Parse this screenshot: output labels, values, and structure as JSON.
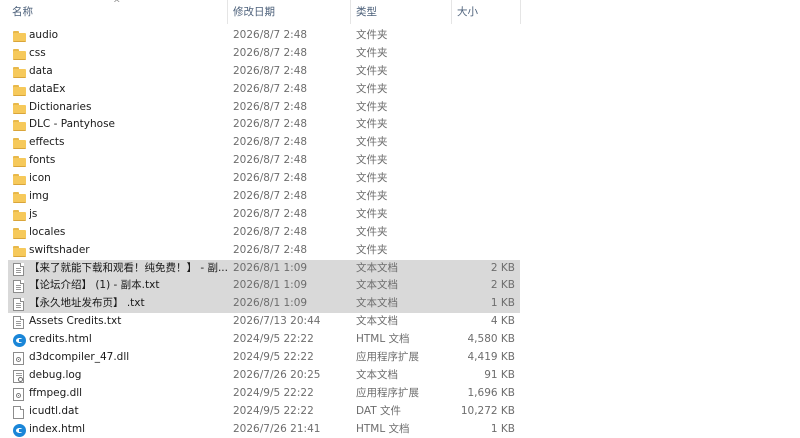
{
  "columns": {
    "name": "名称",
    "date": "修改日期",
    "type": "类型",
    "size": "大小"
  },
  "files": [
    {
      "name": "audio",
      "date": "2026/8/7 2:48",
      "type": "文件夹",
      "size": "",
      "icon": "folder-icon",
      "selected": false
    },
    {
      "name": "css",
      "date": "2026/8/7 2:48",
      "type": "文件夹",
      "size": "",
      "icon": "folder-icon",
      "selected": false
    },
    {
      "name": "data",
      "date": "2026/8/7 2:48",
      "type": "文件夹",
      "size": "",
      "icon": "folder-icon",
      "selected": false
    },
    {
      "name": "dataEx",
      "date": "2026/8/7 2:48",
      "type": "文件夹",
      "size": "",
      "icon": "folder-icon",
      "selected": false
    },
    {
      "name": "Dictionaries",
      "date": "2026/8/7 2:48",
      "type": "文件夹",
      "size": "",
      "icon": "folder-icon",
      "selected": false
    },
    {
      "name": "DLC - Pantyhose",
      "date": "2026/8/7 2:48",
      "type": "文件夹",
      "size": "",
      "icon": "folder-icon",
      "selected": false
    },
    {
      "name": "effects",
      "date": "2026/8/7 2:48",
      "type": "文件夹",
      "size": "",
      "icon": "folder-icon",
      "selected": false
    },
    {
      "name": "fonts",
      "date": "2026/8/7 2:48",
      "type": "文件夹",
      "size": "",
      "icon": "folder-icon",
      "selected": false
    },
    {
      "name": "icon",
      "date": "2026/8/7 2:48",
      "type": "文件夹",
      "size": "",
      "icon": "folder-icon",
      "selected": false
    },
    {
      "name": "img",
      "date": "2026/8/7 2:48",
      "type": "文件夹",
      "size": "",
      "icon": "folder-icon",
      "selected": false
    },
    {
      "name": "js",
      "date": "2026/8/7 2:48",
      "type": "文件夹",
      "size": "",
      "icon": "folder-icon",
      "selected": false
    },
    {
      "name": "locales",
      "date": "2026/8/7 2:48",
      "type": "文件夹",
      "size": "",
      "icon": "folder-icon",
      "selected": false
    },
    {
      "name": "swiftshader",
      "date": "2026/8/7 2:48",
      "type": "文件夹",
      "size": "",
      "icon": "folder-icon",
      "selected": false
    },
    {
      "name": "【来了就能下载和观看！纯免费！】 - 副...",
      "date": "2026/8/1 1:09",
      "type": "文本文档",
      "size": "2 KB",
      "icon": "text-document-icon",
      "selected": true
    },
    {
      "name": "【论坛介绍】 (1) - 副本.txt",
      "date": "2026/8/1 1:09",
      "type": "文本文档",
      "size": "2 KB",
      "icon": "text-document-icon",
      "selected": true
    },
    {
      "name": "【永久地址发布页】 .txt",
      "date": "2026/8/1 1:09",
      "type": "文本文档",
      "size": "1 KB",
      "icon": "text-document-icon",
      "selected": true
    },
    {
      "name": "Assets Credits.txt",
      "date": "2026/7/13 20:44",
      "type": "文本文档",
      "size": "4 KB",
      "icon": "text-document-icon",
      "selected": false
    },
    {
      "name": "credits.html",
      "date": "2024/9/5 22:22",
      "type": "HTML 文档",
      "size": "4,580 KB",
      "icon": "edge-html-icon",
      "selected": false
    },
    {
      "name": "d3dcompiler_47.dll",
      "date": "2024/9/5 22:22",
      "type": "应用程序扩展",
      "size": "4,419 KB",
      "icon": "dll-icon",
      "selected": false
    },
    {
      "name": "debug.log",
      "date": "2026/7/26 20:25",
      "type": "文本文档",
      "size": "91 KB",
      "icon": "log-file-icon",
      "selected": false
    },
    {
      "name": "ffmpeg.dll",
      "date": "2024/9/5 22:22",
      "type": "应用程序扩展",
      "size": "1,696 KB",
      "icon": "dll-icon",
      "selected": false
    },
    {
      "name": "icudtl.dat",
      "date": "2024/9/5 22:22",
      "type": "DAT 文件",
      "size": "10,272 KB",
      "icon": "file-icon",
      "selected": false
    },
    {
      "name": "index.html",
      "date": "2026/7/26 21:41",
      "type": "HTML 文档",
      "size": "1 KB",
      "icon": "edge-html-icon",
      "selected": false
    }
  ]
}
